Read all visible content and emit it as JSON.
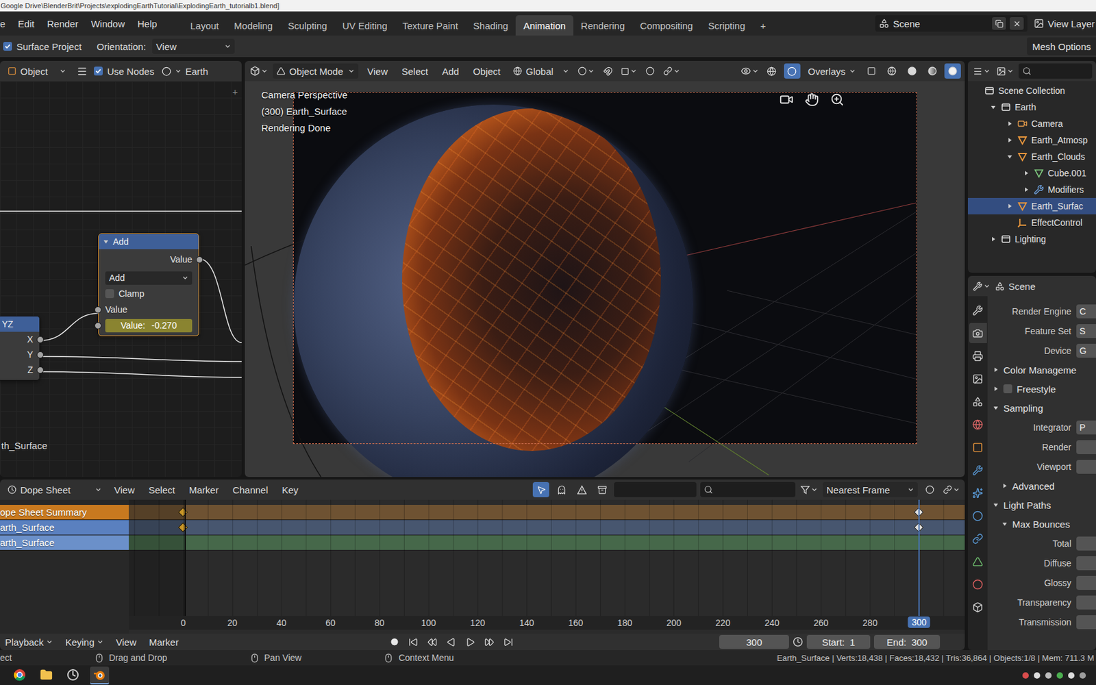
{
  "window": {
    "title": "Google Drive\\BlenderBrit\\Projects\\explodingEarthTutorial\\ExplodingEarth_tutorialb1.blend]"
  },
  "menubar": [
    "e",
    "Edit",
    "Render",
    "Window",
    "Help"
  ],
  "workspaces": [
    {
      "label": "Layout",
      "selected": false
    },
    {
      "label": "Modeling",
      "selected": false
    },
    {
      "label": "Sculpting",
      "selected": false
    },
    {
      "label": "UV Editing",
      "selected": false
    },
    {
      "label": "Texture Paint",
      "selected": false
    },
    {
      "label": "Shading",
      "selected": false
    },
    {
      "label": "Animation",
      "selected": true
    },
    {
      "label": "Rendering",
      "selected": false
    },
    {
      "label": "Compositing",
      "selected": false
    },
    {
      "label": "Scripting",
      "selected": false
    }
  ],
  "add_workspace": "+",
  "scene": "Scene",
  "view_layer": "View Layer",
  "tool_header": {
    "surface_project": {
      "label": "Surface Project",
      "checked": true
    },
    "orientation_label": "Orientation:",
    "orientation": "View",
    "mesh_options": "Mesh Options"
  },
  "node_editor": {
    "header": {
      "editor": "Object",
      "use_nodes": {
        "label": "Use Nodes",
        "checked": true
      },
      "material": "Earth"
    },
    "sidebar_toggle": "+",
    "add_node": {
      "title": "Add",
      "selected": true,
      "output": "Value",
      "operation": "Add",
      "clamp": {
        "label": "Clamp",
        "checked": false
      },
      "input": "Value",
      "field_label": "Value:",
      "field_value": "-0.270",
      "field_keyed": true
    },
    "xyz_node": {
      "title": "YZ",
      "outputs": [
        "X",
        "Y",
        "Z"
      ]
    },
    "frame_label": "th_Surface"
  },
  "viewport": {
    "header": {
      "mode": "Object Mode",
      "menus": [
        "View",
        "Select",
        "Add",
        "Object"
      ],
      "orientation": "Global",
      "overlays": {
        "label": "Overlays",
        "on": true
      },
      "shading": [
        {
          "kind": "wireframe",
          "selected": false
        },
        {
          "kind": "solid",
          "selected": false
        },
        {
          "kind": "material",
          "selected": false
        },
        {
          "kind": "rendered",
          "selected": true
        }
      ]
    },
    "overlay_text": [
      "Camera Perspective",
      "(300) Earth_Surface",
      "Rendering Done"
    ]
  },
  "outliner": {
    "items": [
      {
        "label": "Scene Collection",
        "kind": "scene-collection",
        "depth": 0,
        "expandable": false,
        "expanded": false,
        "selected": false
      },
      {
        "label": "Earth",
        "kind": "collection",
        "depth": 1,
        "expandable": true,
        "expanded": true,
        "selected": false
      },
      {
        "label": "Camera",
        "kind": "camera",
        "depth": 2,
        "expandable": true,
        "expanded": false,
        "selected": false
      },
      {
        "label": "Earth_Atmosp",
        "kind": "object",
        "depth": 2,
        "expandable": true,
        "expanded": false,
        "selected": false
      },
      {
        "label": "Earth_Clouds",
        "kind": "object",
        "depth": 2,
        "expandable": true,
        "expanded": true,
        "selected": false
      },
      {
        "label": "Cube.001",
        "kind": "mesh",
        "depth": 3,
        "expandable": true,
        "expanded": false,
        "selected": false
      },
      {
        "label": "Modifiers",
        "kind": "modifier",
        "depth": 3,
        "expandable": true,
        "expanded": false,
        "selected": false
      },
      {
        "label": "Earth_Surfac",
        "kind": "object",
        "depth": 2,
        "expandable": true,
        "expanded": false,
        "selected": true
      },
      {
        "label": "EffectControl",
        "kind": "empty",
        "depth": 2,
        "expandable": false,
        "expanded": false,
        "selected": false
      },
      {
        "label": "Lighting",
        "kind": "collection",
        "depth": 1,
        "expandable": true,
        "expanded": false,
        "selected": false
      }
    ]
  },
  "properties": {
    "header": "Scene",
    "tabs": [
      {
        "kind": "tool",
        "selected": false
      },
      {
        "kind": "render",
        "selected": true
      },
      {
        "kind": "output",
        "selected": false
      },
      {
        "kind": "view-layer",
        "selected": false
      },
      {
        "kind": "scene",
        "selected": false
      },
      {
        "kind": "world",
        "selected": false
      },
      {
        "kind": "object",
        "selected": false
      },
      {
        "kind": "modifiers",
        "selected": false
      },
      {
        "kind": "particles",
        "selected": false
      },
      {
        "kind": "physics",
        "selected": false
      },
      {
        "kind": "constraints",
        "selected": false
      },
      {
        "kind": "data",
        "selected": false
      },
      {
        "kind": "material",
        "selected": false
      },
      {
        "kind": "texture",
        "selected": false
      }
    ],
    "rows": [
      {
        "kind": "field",
        "label": "Render Engine",
        "value": "C"
      },
      {
        "kind": "field",
        "label": "Feature Set",
        "value": "S"
      },
      {
        "kind": "field",
        "label": "Device",
        "value": "G"
      },
      {
        "kind": "panel",
        "label": "Color Manageme",
        "expanded": false
      },
      {
        "kind": "check-panel",
        "label": "Freestyle",
        "expanded": false,
        "checked": false
      },
      {
        "kind": "panel",
        "label": "Sampling",
        "expanded": true
      },
      {
        "kind": "field",
        "label": "Integrator",
        "value": "P"
      },
      {
        "kind": "field",
        "label": "Render",
        "value": ""
      },
      {
        "kind": "field",
        "label": "Viewport",
        "value": ""
      },
      {
        "kind": "subpanel",
        "label": "Advanced",
        "expanded": false
      },
      {
        "kind": "panel",
        "label": "Light Paths",
        "expanded": true
      },
      {
        "kind": "subpanel",
        "label": "Max Bounces",
        "expanded": true
      },
      {
        "kind": "field",
        "label": "Total",
        "value": ""
      },
      {
        "kind": "field",
        "label": "Diffuse",
        "value": ""
      },
      {
        "kind": "field",
        "label": "Glossy",
        "value": ""
      },
      {
        "kind": "field",
        "label": "Transparency",
        "value": ""
      },
      {
        "kind": "field",
        "label": "Transmission",
        "value": ""
      }
    ]
  },
  "dope_sheet": {
    "editor": "Dope Sheet",
    "menus": [
      "View",
      "Select",
      "Marker",
      "Channel",
      "Key"
    ],
    "filters": [
      {
        "kind": "only-selected",
        "selected": true
      },
      {
        "kind": "show-hidden",
        "selected": false
      },
      {
        "kind": "only-errors",
        "selected": false
      }
    ],
    "snap": "Nearest Frame",
    "channels": [
      {
        "label": "ope Sheet Summary",
        "kind": "summary",
        "color": "#c8791f",
        "track_color": "#6e5232",
        "keyframes": [
          {
            "frame": 0,
            "selected": true
          },
          {
            "frame": 300,
            "selected": false
          }
        ]
      },
      {
        "label": "arth_Surface",
        "kind": "object",
        "color": "#5a80bf",
        "track_color": "#47566f",
        "keyframes": [
          {
            "frame": 0,
            "selected": true
          },
          {
            "frame": 300,
            "selected": false
          }
        ]
      },
      {
        "label": "arth_Surface",
        "kind": "material",
        "color": "#6b90c9",
        "track_color": "#46684a",
        "keyframes": []
      }
    ],
    "ruler": [
      "0",
      "20",
      "40",
      "60",
      "80",
      "100",
      "120",
      "140",
      "160",
      "180",
      "200",
      "220",
      "240",
      "260",
      "280"
    ],
    "current_frame": "300"
  },
  "timeline": {
    "dropdowns": [
      "Playback",
      "Keying"
    ],
    "menus": [
      "View",
      "Marker"
    ],
    "frame": "300",
    "start_label": "Start:",
    "start": "1",
    "end_label": "End:",
    "end": "300"
  },
  "status_bar": {
    "hints": [
      {
        "label": "ect",
        "kind": "text"
      },
      {
        "label": "Drag and Drop",
        "kind": "mouse"
      },
      {
        "label": "Pan View",
        "kind": "mouse"
      },
      {
        "label": "Context Menu",
        "kind": "mouse"
      }
    ],
    "stats": "Earth_Surface | Verts:18,438 | Faces:18,432 | Tris:36,864 | Objects:1/8 | Mem: 711.3 M"
  },
  "taskbar": [
    {
      "kind": "chrome",
      "selected": false
    },
    {
      "kind": "files",
      "selected": false
    },
    {
      "kind": "app",
      "selected": false
    },
    {
      "kind": "blender",
      "selected": true
    }
  ]
}
